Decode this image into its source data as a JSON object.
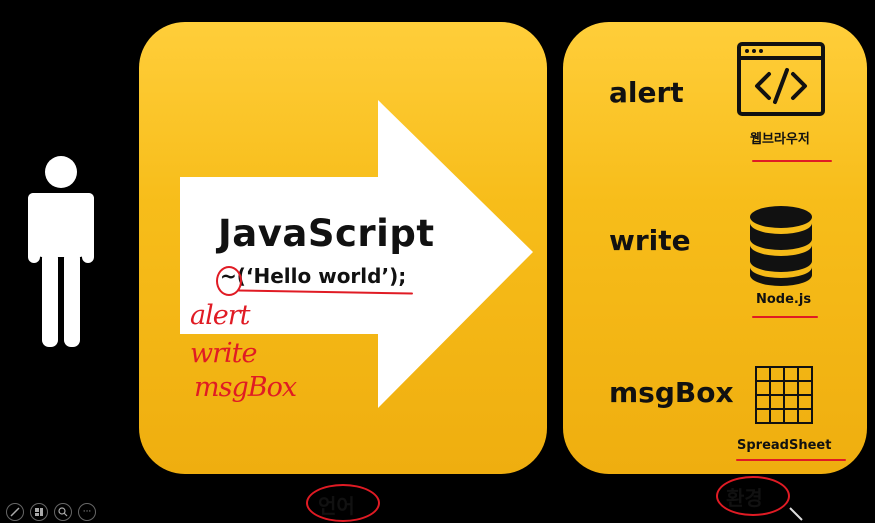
{
  "left_panel": {
    "title": "JavaScript",
    "code": "~(‘Hello world’);",
    "handwritten": [
      "alert",
      "write",
      "msgBox"
    ]
  },
  "right_panel": {
    "items": [
      {
        "label": "alert",
        "icon": "browser-code-icon",
        "caption": "웹브라우저"
      },
      {
        "label": "write",
        "icon": "database-icon",
        "caption": "Node.js"
      },
      {
        "label": "msgBox",
        "icon": "grid-icon",
        "caption": "SpreadSheet"
      }
    ]
  },
  "bottom": {
    "left_label": "언어",
    "right_label": "환경"
  },
  "toolbar": {
    "buttons": [
      "pen-icon",
      "layout-icon",
      "zoom-icon",
      "more-icon"
    ],
    "more_glyph": "···"
  },
  "colors": {
    "panel": "#f7bd1a",
    "annotation": "#e01b24",
    "background": "#000000"
  }
}
